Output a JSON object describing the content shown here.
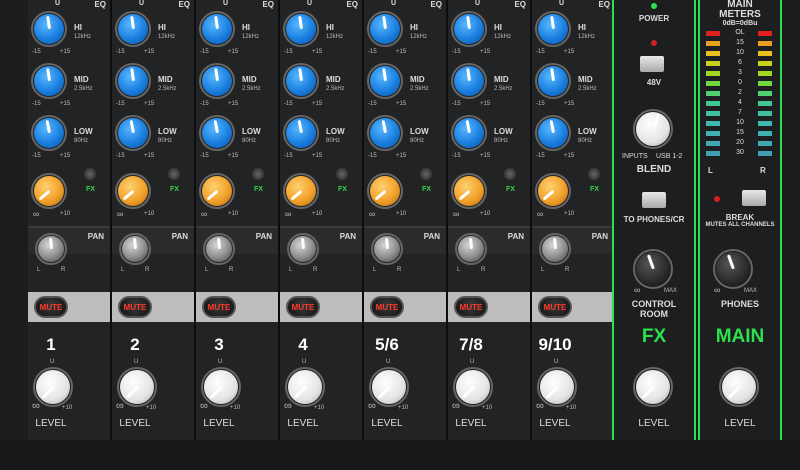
{
  "eq_header": "EQ",
  "eq_bands": [
    {
      "name": "HI",
      "freq": "12kHz"
    },
    {
      "name": "MID",
      "freq": "2.5kHz"
    },
    {
      "name": "LOW",
      "freq": "80Hz"
    }
  ],
  "gain_scale": {
    "min": "-15",
    "max": "+15",
    "center": "U"
  },
  "fx_label": "FX",
  "send_scale": {
    "min": "∞",
    "max": "+10",
    "center": "U"
  },
  "pan": {
    "label": "PAN",
    "left": "L",
    "right": "R"
  },
  "mute_label": "MUTE",
  "level_label": "LEVEL",
  "level_scale": {
    "min": "∞",
    "max": "+10",
    "center": "U"
  },
  "channels": [
    {
      "name": "1"
    },
    {
      "name": "2"
    },
    {
      "name": "3"
    },
    {
      "name": "4"
    },
    {
      "name": "5/6"
    },
    {
      "name": "7/8"
    },
    {
      "name": "9/10"
    }
  ],
  "fx_section": {
    "power_label": "POWER",
    "phantom_label": "48V",
    "blend_inputs": "INPUTS",
    "blend_usb": "USB 1-2",
    "blend_label": "BLEND",
    "to_phones_label": "TO PHONES/CR",
    "control_room_label": "CONTROL ROOM",
    "cr_max": "MAX",
    "cr_min": "∞",
    "section_title": "FX",
    "level_label": "LEVEL"
  },
  "main_section": {
    "meters_title": "MAIN METERS",
    "meters_ref": "0dB=0dBu",
    "meter_scale": [
      "OL",
      "15",
      "10",
      "6",
      "3",
      "0",
      "2",
      "4",
      "7",
      "10",
      "15",
      "20",
      "30"
    ],
    "meter_left": "L",
    "meter_right": "R",
    "break_label": "BREAK",
    "break_sub": "MUTES ALL CHANNELS",
    "phones_label": "PHONES",
    "phones_max": "MAX",
    "phones_min": "∞",
    "section_title": "MAIN",
    "level_label": "LEVEL"
  },
  "colors": {
    "eq_knob": "#1a7fe0",
    "fx_knob": "#f2a12a",
    "accent_green": "#2ee04e",
    "mute_text": "#ff3b2b"
  }
}
